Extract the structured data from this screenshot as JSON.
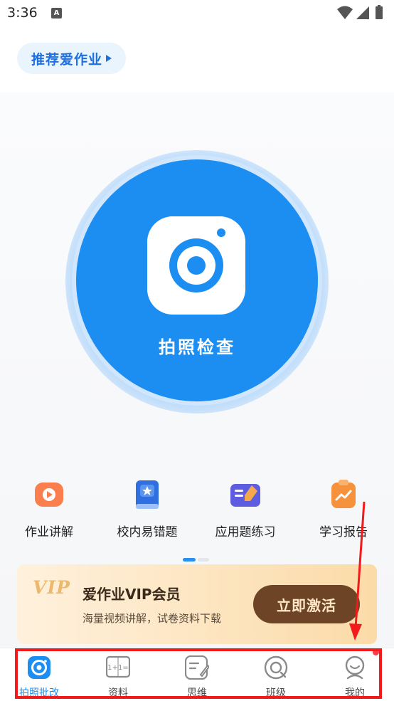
{
  "status_bar": {
    "time": "3:36",
    "notification_letter": "A"
  },
  "recommend": {
    "label": "推荐爱作业"
  },
  "camera": {
    "label": "拍照检查"
  },
  "features": [
    {
      "label": "作业讲解",
      "icon": "video-play-icon"
    },
    {
      "label": "校内易错题",
      "icon": "book-star-icon"
    },
    {
      "label": "应用题练习",
      "icon": "notes-pencil-icon"
    },
    {
      "label": "学习报告",
      "icon": "report-chart-icon"
    }
  ],
  "vip": {
    "logo": "VIP",
    "title": "爱作业VIP会员",
    "subtitle": "海量视频讲解，试卷资料下载",
    "button": "立即激活"
  },
  "tabs": [
    {
      "label": "拍照批改",
      "icon": "camera-tab-icon",
      "active": true
    },
    {
      "label": "资料",
      "icon": "materials-book-icon",
      "icon_text": "1+1="
    },
    {
      "label": "思维",
      "icon": "thinking-note-icon"
    },
    {
      "label": "班级",
      "icon": "class-circle-icon"
    },
    {
      "label": "我的",
      "icon": "profile-icon",
      "badge": true
    }
  ],
  "colors": {
    "primary": "#1c8ef2",
    "vip_button": "#6e4427",
    "highlight": "#f21a1a"
  }
}
